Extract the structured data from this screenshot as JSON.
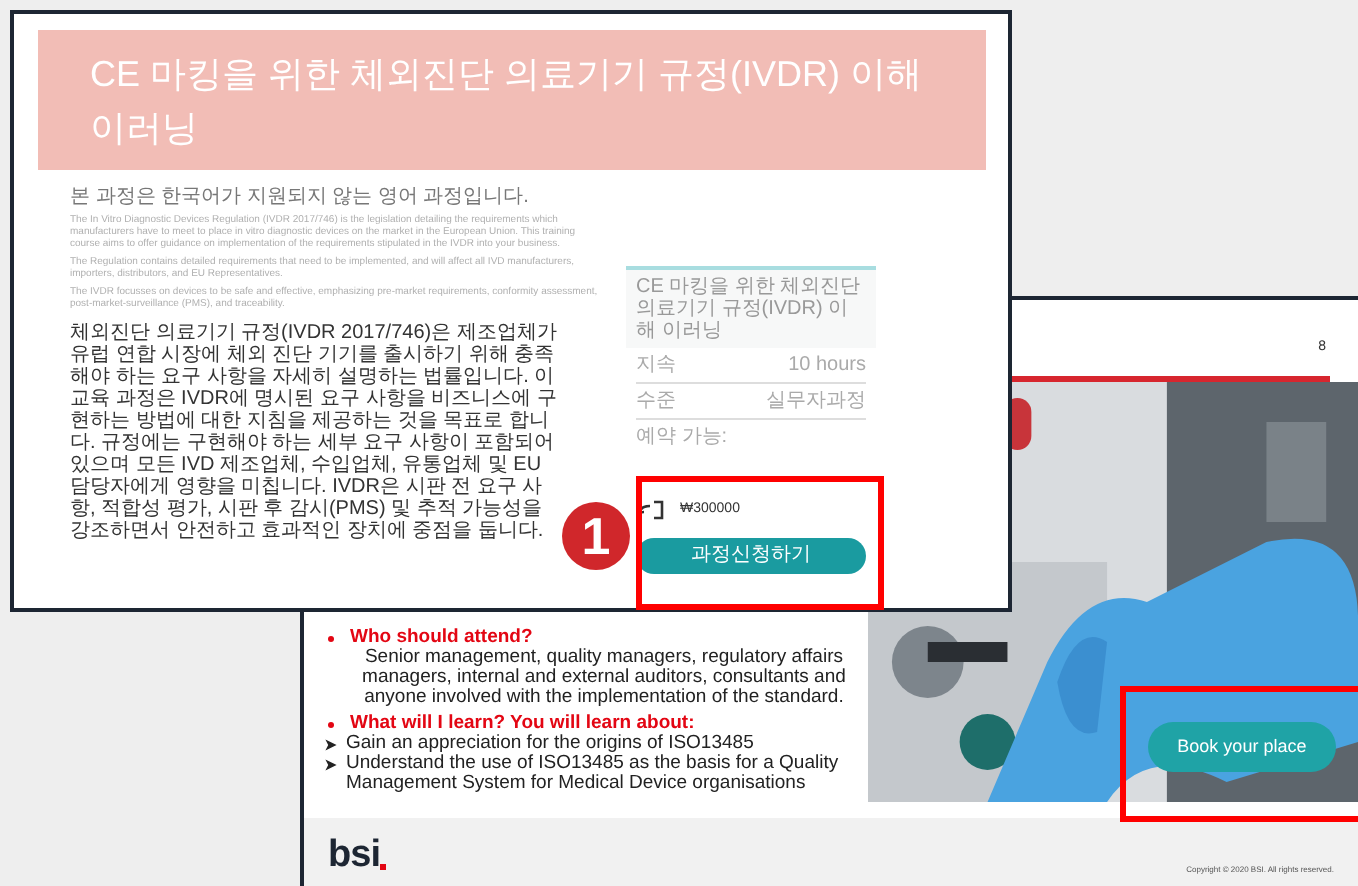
{
  "course_page": {
    "title": "CE 마킹을 위한 체외진단 의료기기 규정(IVDR) 이해 이러닝",
    "notice": "본 과정은 한국어가 지원되지 않는 영어 과정입니다.",
    "paragraphs": [
      "The In Vitro Diagnostic Devices Regulation (IVDR 2017/746) is the legislation detailing the requirements which manufacturers have to meet to place in vitro diagnostic devices on the market in the European Union. This training course aims to offer guidance on implementation of the requirements stipulated in the IVDR into your business.",
      "The Regulation contains detailed requirements that need to be implemented, and will affect all IVD manufacturers, importers, distributors, and EU Representatives.",
      "The IVDR focusses on devices to be safe and effective, emphasizing pre-market requirements, conformity assessment, post-market-surveillance (PMS), and traceability."
    ],
    "summary": "체외진단 의료기기 규정(IVDR 2017/746)은 제조업체가 유럽 연합 시장에 체외 진단 기기를 출시하기 위해 충족해야 하는 요구 사항을 자세히 설명하는 법률입니다. 이 교육 과정은 IVDR에 명시된 요구 사항을 비즈니스에 구현하는 방법에 대한 지침을 제공하는 것을 목표로 합니다. 규정에는 구현해야 하는 세부 요구 사항이 포함되어 있으며 모든 IVD 제조업체, 수입업체, 유통업체 및 EU 담당자에게 영향을 미칩니다. IVDR은 시판 전 요구 사항, 적합성 평가, 시판 후 감시(PMS) 및 추적 가능성을 강조하면서 안전하고 효과적인 장치에 중점을 둡니다.",
    "sidebar": {
      "title": "CE 마킹을 위한 체외진단 의료기기 규정(IVDR) 이해 이러닝",
      "details": [
        {
          "label": "지속",
          "value": "10 hours"
        },
        {
          "label": "수준",
          "value": "실무자과정"
        }
      ],
      "availability_label": "예약 가능:",
      "price": "₩300000",
      "button": "과정신청하기"
    }
  },
  "brochure": {
    "page_number": "8",
    "sections": [
      {
        "kind": "paragraph",
        "heading": "Who should attend?",
        "items": [
          "Senior management, quality managers, regulatory affairs managers, internal and external auditors, consultants and anyone involved with the implementation of the standard."
        ]
      },
      {
        "kind": "list",
        "heading": "What will I learn? You will learn about:",
        "items": [
          "Gain an appreciation for the origins of ISO13485",
          "Understand the use of ISO13485 as the basis for a Quality Management System for Medical Device organisations"
        ]
      }
    ],
    "button": "Book your place",
    "logo": "bsi",
    "copyright": "Copyright © 2020 BSI. All rights reserved."
  },
  "annotation": {
    "step": "1"
  }
}
